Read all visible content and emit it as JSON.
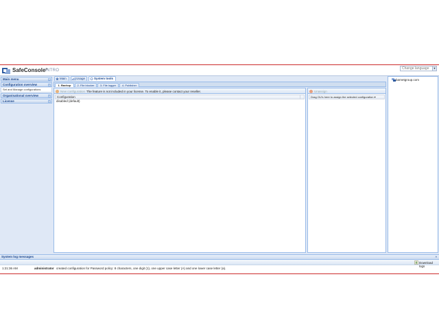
{
  "app": {
    "title": "SafeConsole",
    "title_mark": "®",
    "edition": "INTRO",
    "language_placeholder": "Change language",
    "colors": {
      "accent": "#15428b",
      "border": "#99bbe8",
      "frame": "#cc2a2a"
    }
  },
  "sidebar": {
    "sections": [
      {
        "label": "Main menu"
      },
      {
        "label": "Configuration overview"
      },
      {
        "label": "Organisational overview"
      },
      {
        "label": "License"
      }
    ],
    "items": [
      {
        "label": "Set and Manage configurations"
      }
    ]
  },
  "tabs": {
    "main": [
      {
        "label": "Main",
        "icon": "home-icon"
      },
      {
        "label": "Usage",
        "icon": "chart-icon"
      },
      {
        "label": "System tools",
        "icon": "tools-icon",
        "active": true
      }
    ],
    "sub": [
      {
        "label": "1. Backup",
        "active": true
      },
      {
        "label": "2. File blocker"
      },
      {
        "label": "3. File logger"
      },
      {
        "label": "4. Publisher"
      }
    ]
  },
  "config_panel": {
    "new_button": "New configuration",
    "license_note": "The feature is not included in your license. To enable it, please contact your reseller.",
    "column": "Configuration",
    "rows": [
      "disabled (default)"
    ]
  },
  "usage_panel": {
    "unassign_button": "Unassign",
    "column": "Drag OU's here to assign the selected configuration"
  },
  "tree": {
    "item": "barnetgroup.com",
    "icon": "domain-icon"
  },
  "log": {
    "header": "System log messages",
    "download": "Download logs",
    "entry": {
      "time": "1:21:36 AM",
      "user": "administrator",
      "message": "created configuration for Password policy: 8 characters, one digit (1), one upper case letter (A) and one lower case letter (a)."
    }
  }
}
